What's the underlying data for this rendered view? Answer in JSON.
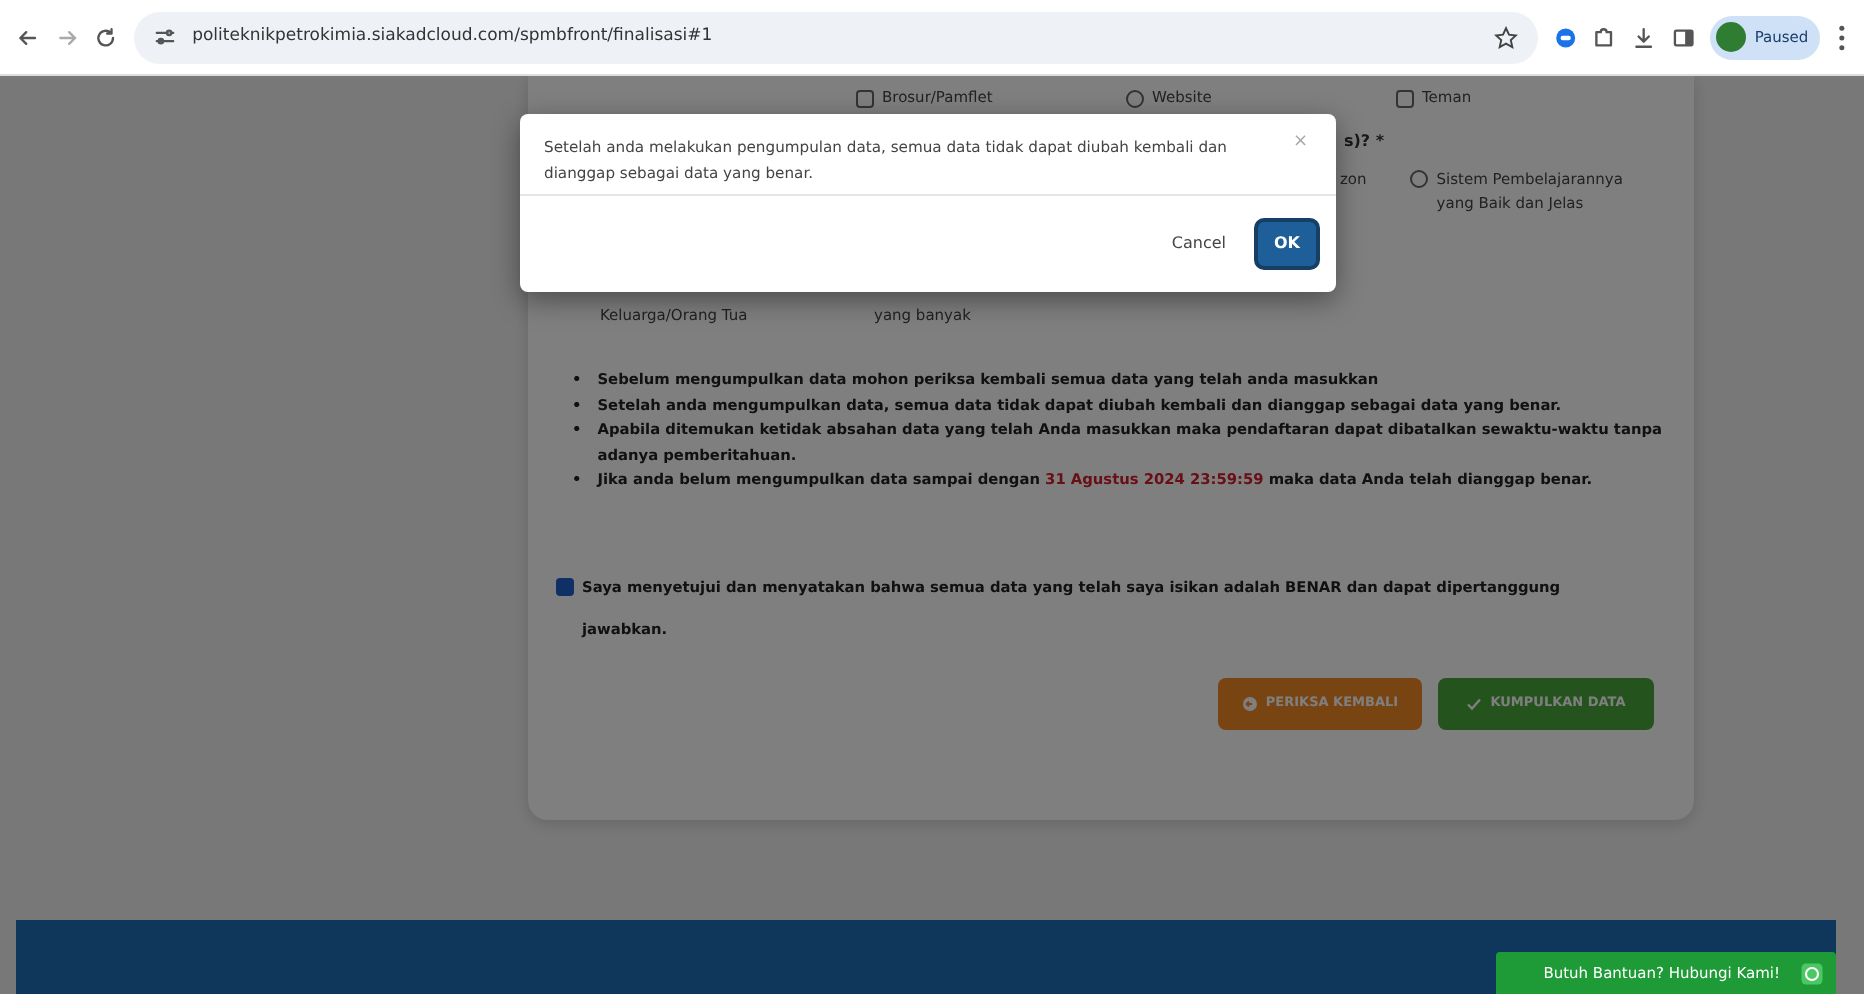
{
  "browser": {
    "url": "politeknikpetrokimia.siakadcloud.com/spmbfront/finalisasi#1",
    "profile_label": "Paused"
  },
  "form": {
    "option_row": [
      {
        "label": "Brosur/Pamflet",
        "kind": "checkbox",
        "checked": false
      },
      {
        "label": "Website",
        "kind": "radio",
        "checked": false
      },
      {
        "label": "Teman",
        "kind": "checkbox",
        "checked": false
      }
    ],
    "question_fragment": "s)? *",
    "covered_fragment": "zon",
    "side_option": {
      "label": "Sistem Pembelajarannya yang Baik dan Jelas",
      "kind": "radio",
      "checked": false
    },
    "lower_labels": [
      "Keluarga/Orang Tua",
      "yang banyak"
    ],
    "notes": [
      {
        "marker": "•",
        "text": "Sebelum mengumpulkan data mohon periksa kembali semua data yang telah anda masukkan"
      },
      {
        "marker": "•",
        "text": "Setelah anda mengumpulkan data, semua data tidak dapat diubah kembali dan dianggap sebagai data yang benar."
      },
      {
        "marker": "•",
        "text": "Apabila ditemukan ketidak absahan data yang telah Anda masukkan maka pendaftaran dapat dibatalkan sewaktu-waktu tanpa adanya pemberitahuan."
      },
      {
        "marker": "•",
        "text": "Jika anda belum mengumpulkan data sampai dengan ",
        "highlight": "31 Agustus 2024 23:59:59",
        "after": " maka data Anda telah dianggap benar."
      }
    ],
    "agreement": {
      "checked": true,
      "text": "Saya menyetujui dan menyatakan bahwa semua data yang telah saya isikan adalah BENAR dan dapat dipertanggung jawabkan."
    },
    "buttons": [
      {
        "kind": "back",
        "label": "PERIKSA KEMBALI"
      },
      {
        "kind": "submit",
        "label": "KUMPULKAN DATA"
      }
    ]
  },
  "dialog": {
    "message": "Setelah anda melakukan pengumpulan data, semua data tidak dapat diubah kembali dan dianggap sebagai data yang benar.",
    "close": "×",
    "cancel": "Cancel",
    "ok": "OK"
  },
  "help_button": {
    "label": "Butuh Bantuan? Hubungi Kami!"
  }
}
